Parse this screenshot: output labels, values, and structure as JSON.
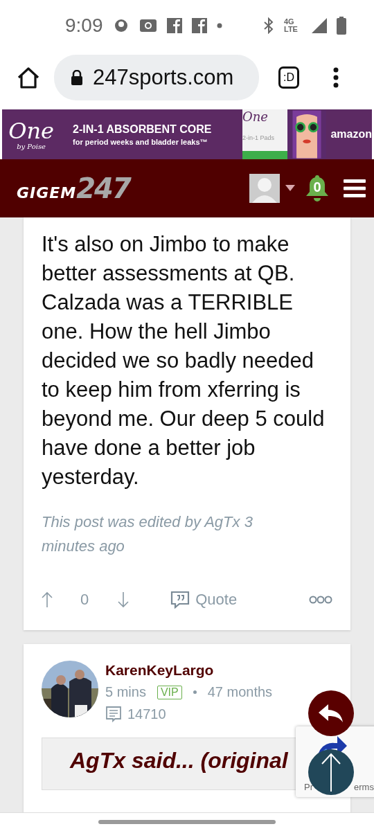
{
  "status_bar": {
    "time": "9:09",
    "network": "4G LTE"
  },
  "browser": {
    "url": "247sports.com",
    "tab_label": ":D"
  },
  "ad": {
    "logo": "One",
    "logo_sub": "by Poise",
    "headline": "2-IN-1 ABSORBENT CORE",
    "subline": "for period weeks and bladder leaks™",
    "product_logo": "One",
    "product_label": "2-in-1 Pads",
    "retailer": "amazon"
  },
  "site_header": {
    "logo_text": "GIGEM",
    "logo_number": "247",
    "notifications": "0"
  },
  "post": {
    "body": "It's also on Jimbo to make better assessments at QB. Calzada was a TERRIBLE one. How the hell Jimbo decided we so badly needed to keep him from xferring is beyond me. Our deep 5 could have done a better job yesterday.",
    "edited_note": "This post was edited by AgTx 3 minutes ago",
    "score": "0",
    "quote_label": "Quote"
  },
  "next_post": {
    "author": "KarenKeyLargo",
    "time": "5 mins",
    "badge": "VIP",
    "tenure": "47 months",
    "post_count": "14710",
    "quote_header": "AgTx said... (original"
  },
  "recaptcha": {
    "left_text": "Pr",
    "right_text": "erms"
  }
}
